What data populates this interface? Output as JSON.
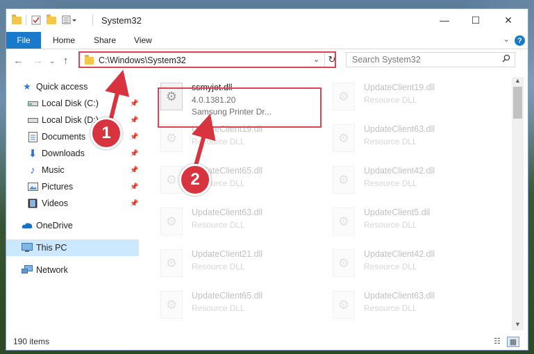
{
  "window": {
    "title": "System32",
    "controls": {
      "minimize": "—",
      "maximize": "☐",
      "close": "✕"
    }
  },
  "ribbon": {
    "tabs": [
      {
        "label": "File"
      },
      {
        "label": "Home"
      },
      {
        "label": "Share"
      },
      {
        "label": "View"
      }
    ],
    "help": "?"
  },
  "address": {
    "path": "C:\\Windows\\System32",
    "search_placeholder": "Search System32"
  },
  "sidebar": {
    "items": [
      {
        "label": "Quick access",
        "icon": "star-icon",
        "pinned": false
      },
      {
        "label": "Local Disk (C:)",
        "icon": "drive-icon",
        "pinned": true
      },
      {
        "label": "Local Disk (D:)",
        "icon": "drive-icon",
        "pinned": true
      },
      {
        "label": "Documents",
        "icon": "documents-icon",
        "pinned": true
      },
      {
        "label": "Downloads",
        "icon": "download-icon",
        "pinned": true
      },
      {
        "label": "Music",
        "icon": "music-icon",
        "pinned": true
      },
      {
        "label": "Pictures",
        "icon": "pictures-icon",
        "pinned": true
      },
      {
        "label": "Videos",
        "icon": "videos-icon",
        "pinned": true
      },
      {
        "label": "OneDrive",
        "icon": "cloud-icon",
        "pinned": false
      },
      {
        "label": "This PC",
        "icon": "computer-icon",
        "pinned": false,
        "selected": true
      },
      {
        "label": "Network",
        "icon": "network-icon",
        "pinned": false
      }
    ]
  },
  "files": [
    {
      "name": "ssmyjet.dll",
      "line1": "4.0.1381.20",
      "line2": "Samsung Printer Dr...",
      "highlighted": true
    },
    {
      "name": "UpdateClient19.dll",
      "line1": "Resource DLL"
    },
    {
      "name": "UpdateClient19.dll",
      "line1": "Resource DLL"
    },
    {
      "name": "UpdateClient63.dll",
      "line1": "Resource DLL"
    },
    {
      "name": "UpdateClient65.dll",
      "line1": "Resource DLL"
    },
    {
      "name": "UpdateClient42.dll",
      "line1": "Resource DLL"
    },
    {
      "name": "UpdateClient63.dll",
      "line1": "Resource DLL"
    },
    {
      "name": "UpdateClient5.dll",
      "line1": "Resource DLL"
    },
    {
      "name": "UpdateClient21.dll",
      "line1": "Resource DLL"
    },
    {
      "name": "UpdateClient42.dll",
      "line1": "Resource DLL"
    },
    {
      "name": "UpdateClient65.dll",
      "line1": "Resource DLL"
    },
    {
      "name": "UpdateClient63.dll",
      "line1": "Resource DLL"
    }
  ],
  "status": {
    "item_count": "190 items"
  },
  "annotations": {
    "step1": "1",
    "step2": "2"
  },
  "colors": {
    "accent": "#1979ca",
    "highlight": "#e0434f",
    "selection": "#cce8ff"
  }
}
